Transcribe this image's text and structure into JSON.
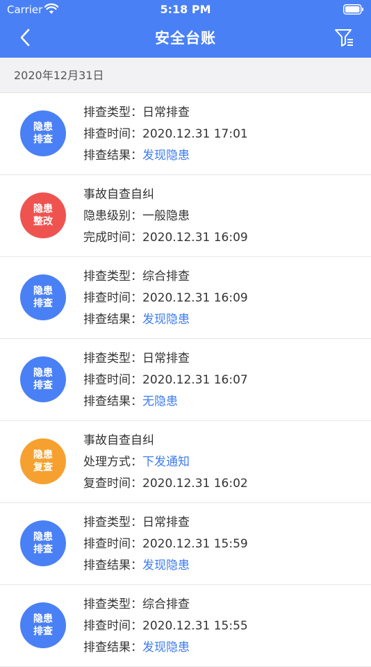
{
  "status_bar": {
    "carrier": "Carrier",
    "time": "5:18 PM"
  },
  "nav": {
    "title": "安全台账"
  },
  "date_header": "2020年12月31日",
  "colors": {
    "blue": "#4a80f5",
    "red": "#ef5350",
    "orange": "#f6a12f",
    "link": "#3d7cf2"
  },
  "records": [
    {
      "badge": [
        "隐患",
        "排查"
      ],
      "badge_color": "#4a80f5",
      "lines": [
        {
          "label": "排查类型：",
          "value": "日常排查",
          "link": false
        },
        {
          "label": "排查时间：",
          "value": "2020.12.31 17:01",
          "link": false
        },
        {
          "label": "排查结果：",
          "value": "发现隐患",
          "link": true
        }
      ]
    },
    {
      "badge": [
        "隐患",
        "整改"
      ],
      "badge_color": "#ef5350",
      "lines": [
        {
          "label": "",
          "value": "事故自查自纠",
          "link": false
        },
        {
          "label": "隐患级别：",
          "value": "一般隐患",
          "link": false
        },
        {
          "label": "完成时间：",
          "value": "2020.12.31 16:09",
          "link": false
        }
      ]
    },
    {
      "badge": [
        "隐患",
        "排查"
      ],
      "badge_color": "#4a80f5",
      "lines": [
        {
          "label": "排查类型：",
          "value": "综合排查",
          "link": false
        },
        {
          "label": "排查时间：",
          "value": "2020.12.31 16:09",
          "link": false
        },
        {
          "label": "排查结果：",
          "value": "发现隐患",
          "link": true
        }
      ]
    },
    {
      "badge": [
        "隐患",
        "排查"
      ],
      "badge_color": "#4a80f5",
      "lines": [
        {
          "label": "排查类型：",
          "value": "日常排查",
          "link": false
        },
        {
          "label": "排查时间：",
          "value": "2020.12.31 16:07",
          "link": false
        },
        {
          "label": "排查结果：",
          "value": "无隐患",
          "link": true
        }
      ]
    },
    {
      "badge": [
        "隐患",
        "复查"
      ],
      "badge_color": "#f6a12f",
      "lines": [
        {
          "label": "",
          "value": "事故自查自纠",
          "link": false
        },
        {
          "label": "处理方式：",
          "value": "下发通知",
          "link": true
        },
        {
          "label": "复查时间：",
          "value": "2020.12.31 16:02",
          "link": false
        }
      ]
    },
    {
      "badge": [
        "隐患",
        "排查"
      ],
      "badge_color": "#4a80f5",
      "lines": [
        {
          "label": "排查类型：",
          "value": "日常排查",
          "link": false
        },
        {
          "label": "排查时间：",
          "value": "2020.12.31 15:59",
          "link": false
        },
        {
          "label": "排查结果：",
          "value": "发现隐患",
          "link": true
        }
      ]
    },
    {
      "badge": [
        "隐患",
        "排查"
      ],
      "badge_color": "#4a80f5",
      "lines": [
        {
          "label": "排查类型：",
          "value": "综合排查",
          "link": false
        },
        {
          "label": "排查时间：",
          "value": "2020.12.31 15:55",
          "link": false
        },
        {
          "label": "排查结果：",
          "value": "发现隐患",
          "link": true
        }
      ]
    }
  ]
}
